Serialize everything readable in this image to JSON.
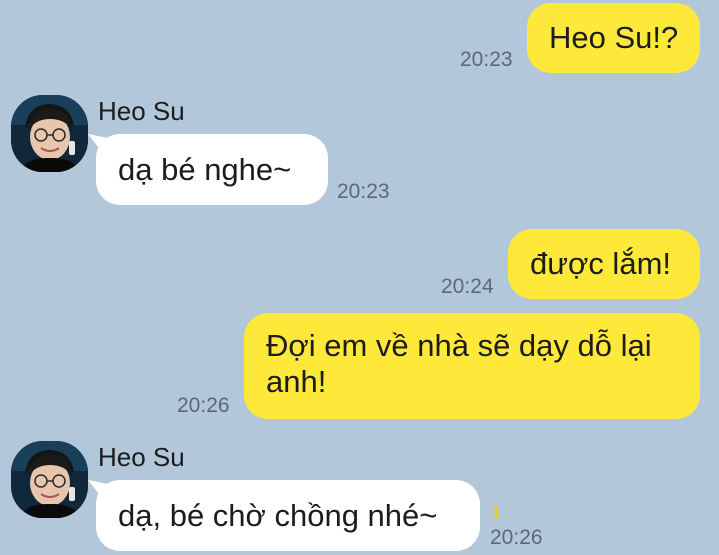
{
  "messages": [
    {
      "direction": "sent",
      "text": "Heo Su!?",
      "time": "20:23"
    },
    {
      "direction": "received",
      "sender": "Heo Su",
      "text": "dạ bé nghe~",
      "time": "20:23"
    },
    {
      "direction": "sent",
      "text": "được lắm!",
      "time": "20:24"
    },
    {
      "direction": "sent",
      "text": "Đợi em về nhà sẽ dạy dỗ lại anh!",
      "time": "20:26"
    },
    {
      "direction": "received",
      "sender": "Heo Su",
      "text": "dạ, bé chờ chồng nhé~",
      "time": "20:26",
      "unread": "1"
    }
  ],
  "colors": {
    "background": "#b2c7da",
    "sent_bubble": "#fee93b",
    "received_bubble": "#ffffff",
    "unread_count": "#e6cc2e"
  },
  "icons": {
    "avatar": "contact-avatar-photo"
  }
}
